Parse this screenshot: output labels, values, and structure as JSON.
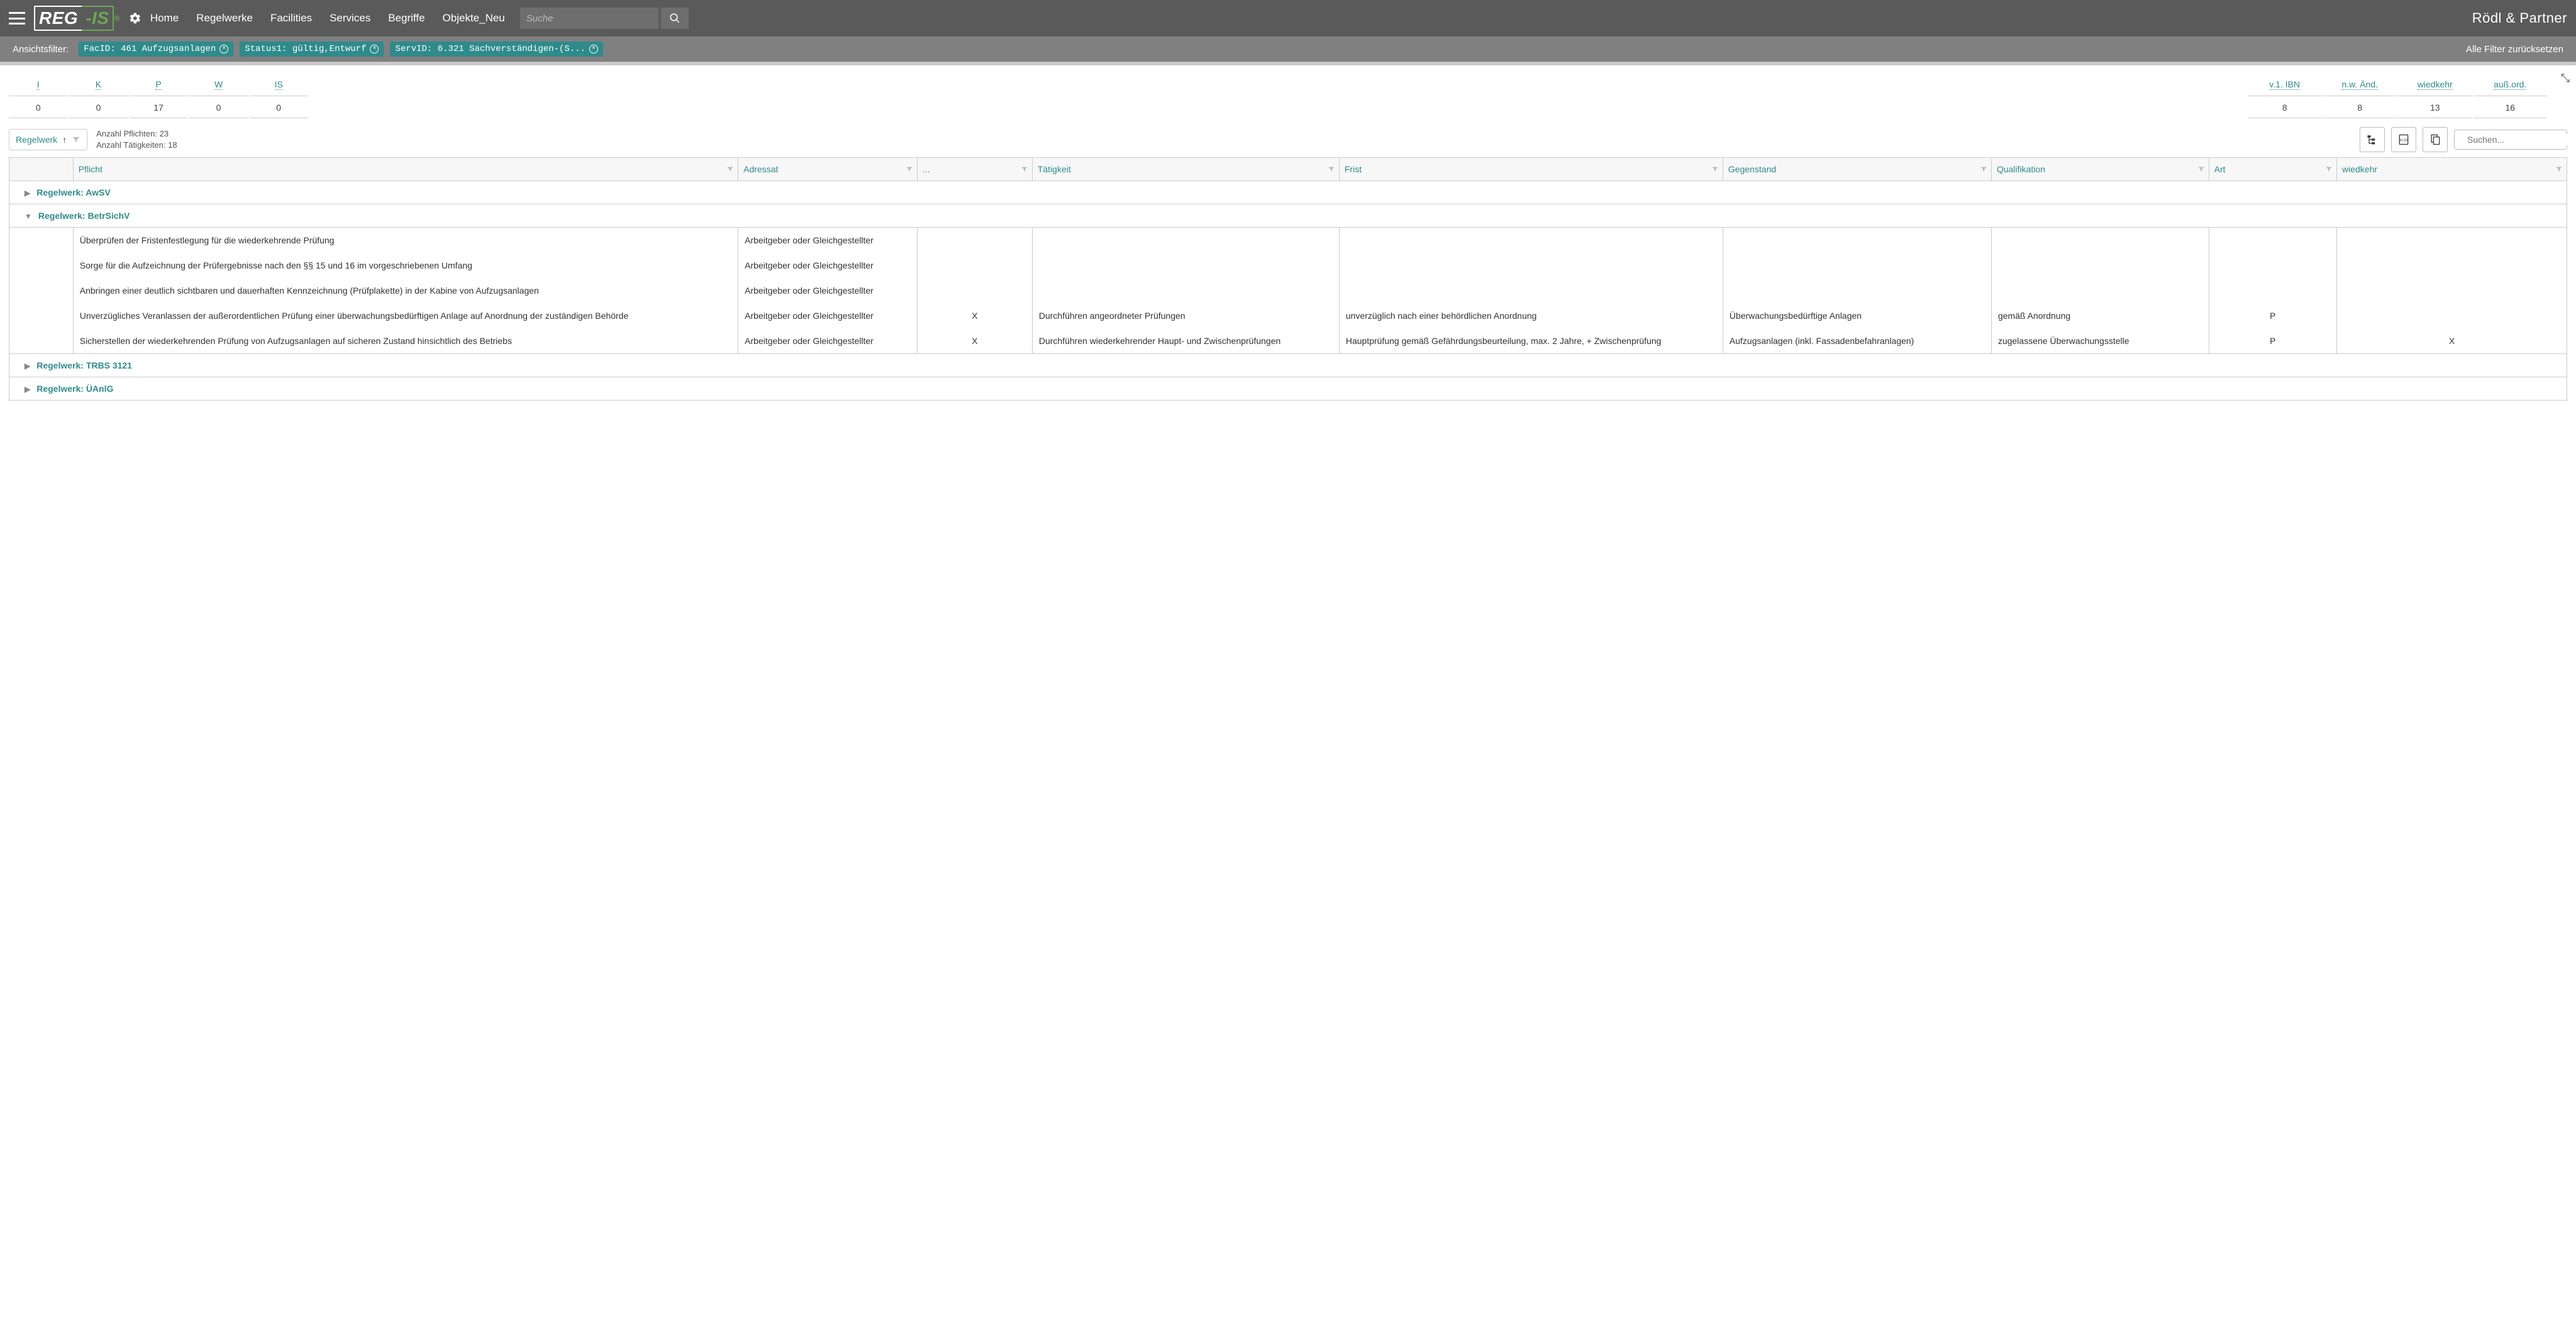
{
  "header": {
    "logo_part1": "REG",
    "logo_part2": "-IS",
    "logo_sup": "®",
    "brand_right": "Rödl & Partner",
    "search_placeholder": "Suche",
    "nav": [
      "Home",
      "Regelwerke",
      "Facilities",
      "Services",
      "Begriffe",
      "Objekte_Neu"
    ]
  },
  "filter_bar": {
    "label": "Ansichtsfilter:",
    "chips": [
      "FacID: 461 Aufzugsanlagen",
      "Status1: gültig,Entwurf",
      "ServID: 6.321 Sachverständigen-(S..."
    ],
    "reset": "Alle Filter zurücksetzen"
  },
  "stats_left": {
    "headers": [
      "I",
      "K",
      "P",
      "W",
      "IS"
    ],
    "values": [
      "0",
      "0",
      "17",
      "0",
      "0"
    ]
  },
  "stats_right": {
    "headers": [
      "v.1. IBN",
      "n.w. Änd.",
      "wiedkehr",
      "auß.ord."
    ],
    "values": [
      "8",
      "8",
      "13",
      "16"
    ]
  },
  "toolbar": {
    "sort_label": "Regelwerk",
    "count_pflichten_label": "Anzahl Pflichten:",
    "count_pflichten_value": "23",
    "count_taetigkeiten_label": "Anzahl Tätigkeiten:",
    "count_taetigkeiten_value": "18",
    "search_placeholder": "Suchen..."
  },
  "columns": [
    "Pflicht",
    "Adressat",
    "...",
    "Tätigkeit",
    "Frist",
    "Gegenstand",
    "Qualifikation",
    "Art",
    "wiedkehr"
  ],
  "groups": [
    {
      "label": "Regelwerk: AwSV",
      "expanded": false
    },
    {
      "label": "Regelwerk: BetrSichV",
      "expanded": true
    },
    {
      "label": "Regelwerk: TRBS 3121",
      "expanded": false
    },
    {
      "label": "Regelwerk: ÜAnlG",
      "expanded": false
    }
  ],
  "rows": [
    {
      "pflicht": "Überprüfen der Fristenfestlegung für die wiederkehrende Prüfung",
      "adressat": "Arbeitgeber oder Gleichgestellter",
      "x": "",
      "taetigkeit": "",
      "frist": "",
      "gegenstand": "",
      "qualifikation": "",
      "art": "",
      "wiedkehr": ""
    },
    {
      "pflicht": "Sorge für die Aufzeichnung der Prüfergebnisse nach den §§ 15 und 16 im vorgeschriebenen Umfang",
      "adressat": "Arbeitgeber oder Gleichgestellter",
      "x": "",
      "taetigkeit": "",
      "frist": "",
      "gegenstand": "",
      "qualifikation": "",
      "art": "",
      "wiedkehr": ""
    },
    {
      "pflicht": "Anbringen einer deutlich sichtbaren und dauerhaften Kennzeichnung (Prüfplakette) in der Kabine von Aufzugsanlagen",
      "adressat": "Arbeitgeber oder Gleichgestellter",
      "x": "",
      "taetigkeit": "",
      "frist": "",
      "gegenstand": "",
      "qualifikation": "",
      "art": "",
      "wiedkehr": ""
    },
    {
      "pflicht": "Unverzügliches Veranlassen der außerordentlichen Prüfung einer überwachungsbedürftigen Anlage auf Anordnung der zuständigen Behörde",
      "adressat": "Arbeitgeber oder Gleichgestellter",
      "x": "X",
      "taetigkeit": "Durchführen angeordneter Prüfungen",
      "frist": "unverzüglich nach einer behördlichen Anordnung",
      "gegenstand": "Überwachungsbedürftige Anlagen",
      "qualifikation": "gemäß Anordnung",
      "art": "P",
      "wiedkehr": ""
    },
    {
      "pflicht": "Sicherstellen der wiederkehrenden Prüfung von Aufzugsanlagen auf sicheren Zustand hinsichtlich des Betriebs",
      "adressat": "Arbeitgeber oder Gleichgestellter",
      "x": "X",
      "taetigkeit": "Durchführen wiederkehrender Haupt- und Zwischenprüfungen",
      "frist": "Hauptprüfung gemäß Gefährdungsbeurteilung, max. 2 Jahre, + Zwischenprüfung",
      "gegenstand": "Aufzugsanlagen (inkl. Fassadenbefahranlagen)",
      "qualifikation": "zugelassene Überwachungsstelle",
      "art": "P",
      "wiedkehr": "X"
    }
  ]
}
